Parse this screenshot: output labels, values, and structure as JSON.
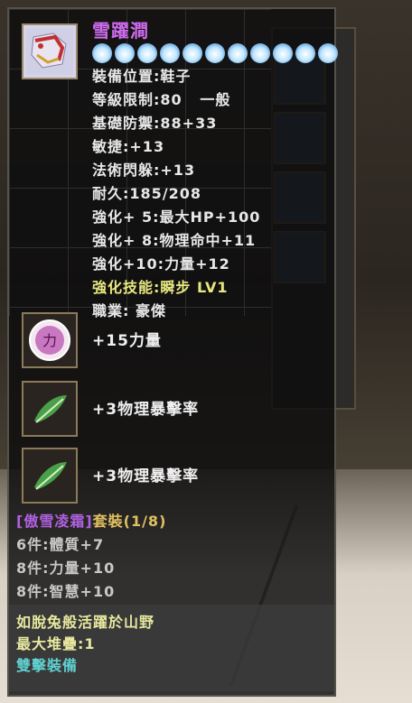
{
  "item": {
    "name": "雪躍澗",
    "enhance_stars": 11,
    "icon": "boots-icon"
  },
  "stats": [
    {
      "text": "裝備位置:鞋子",
      "type": "normal"
    },
    {
      "text": "等級限制:80   一般",
      "type": "normal"
    },
    {
      "text": "基礎防禦:88+33",
      "type": "normal"
    },
    {
      "text": "敏捷:+13",
      "type": "normal"
    },
    {
      "text": "法術閃躲:+13",
      "type": "normal"
    },
    {
      "text": "耐久:185/208",
      "type": "normal"
    },
    {
      "text": "強化+ 5:最大HP+100",
      "type": "normal"
    },
    {
      "text": "強化+ 8:物理命中+11",
      "type": "normal"
    },
    {
      "text": "強化+10:力量+12",
      "type": "normal"
    },
    {
      "text": "強化技能:瞬步 LV1",
      "type": "skill"
    },
    {
      "text": "職業: 豪傑",
      "type": "normal"
    }
  ],
  "gems": [
    {
      "label": "+15力量",
      "icon": "strength-orb-icon",
      "glyph": "力"
    },
    {
      "label": "+3物理暴擊率",
      "icon": "green-feather-icon"
    },
    {
      "label": "+3物理暴擊率",
      "icon": "green-feather-icon"
    }
  ],
  "set": {
    "name": "[傲雪凌霜]",
    "suffix": "套裝(1/8)",
    "bonuses": [
      "6件:體質+7",
      "8件:力量+10",
      "8件:智慧+10"
    ]
  },
  "description": {
    "flavor": "如脫兔般活躍於山野",
    "stack": "最大堆疊:1",
    "type_label": "雙擊裝備"
  },
  "colors": {
    "name": "#d06cf0",
    "skill": "#e8e880",
    "set_name": "#b060e0",
    "set_suffix": "#e0c060",
    "flavor": "#e8e8a0",
    "stack": "#e8e8a0",
    "type_label": "#60d0d0"
  }
}
